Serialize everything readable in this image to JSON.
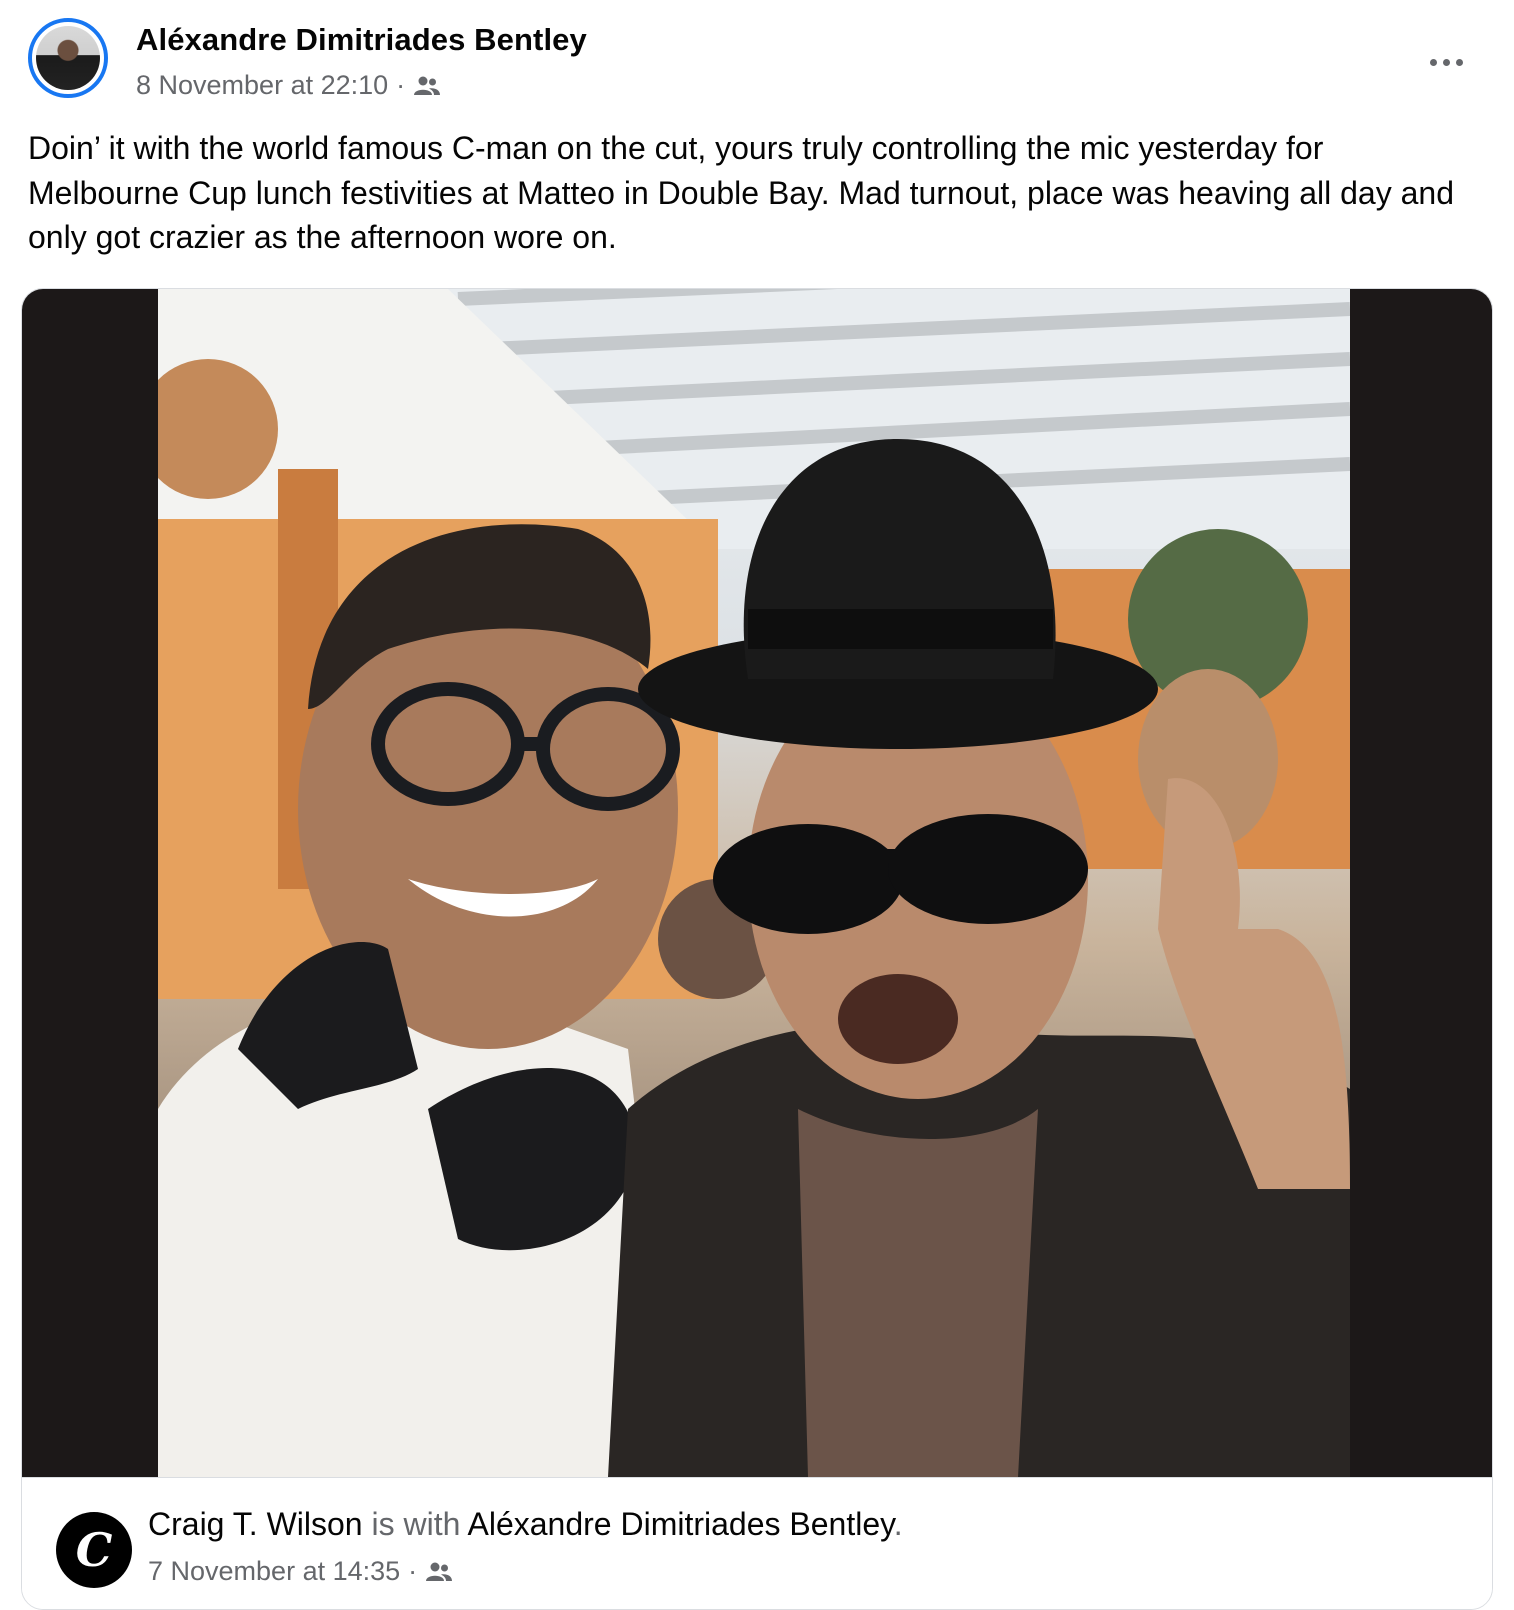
{
  "post": {
    "author": "Aléxandre Dimitriades Bentley",
    "timestamp": "8 November at 22:10",
    "separator": "·",
    "audience_icon": "friends-icon",
    "more_icon": "more-options-icon",
    "text": "Doin’ it with the world famous C-man on the  cut, yours truly controlling the mic yesterday for Melbourne Cup lunch festivities at Matteo in Double Bay. Mad turnout, place was heaving all day and only got crazier as the afternoon wore on."
  },
  "shared": {
    "author": "Craig T. Wilson",
    "is_with": " is with ",
    "tagged": "Aléxandre Dimitriades Bentley",
    "period": ".",
    "timestamp": "7 November at 14:35",
    "separator": "·",
    "audience_icon": "friends-icon",
    "avatar_letter": "C"
  },
  "colors": {
    "accent": "#1877f2",
    "secondary_text": "#65676b",
    "photo_frame": "#1c1818"
  }
}
